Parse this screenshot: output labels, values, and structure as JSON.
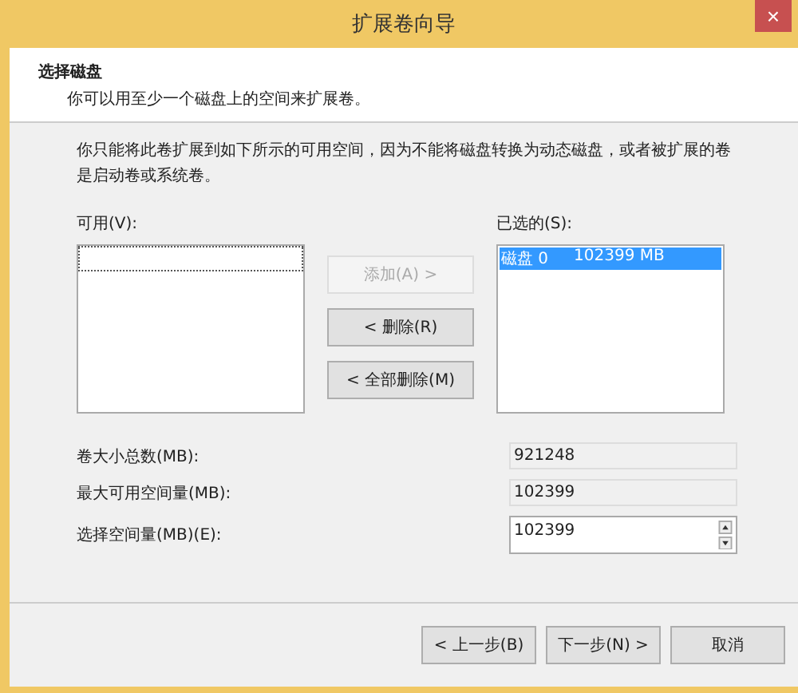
{
  "window": {
    "title": "扩展卷向导",
    "close": "×"
  },
  "header": {
    "title": "选择磁盘",
    "subtitle": "你可以用至少一个磁盘上的空间来扩展卷。"
  },
  "description": "你只能将此卷扩展到如下所示的可用空间，因为不能将磁盘转换为动态磁盘，或者被扩展的卷是启动卷或系统卷。",
  "available": {
    "label": "可用(V):"
  },
  "transfer_buttons": [
    {
      "label": "添加(A) >",
      "disabled": true
    },
    {
      "label": "< 删除(R)",
      "disabled": false
    },
    {
      "label": "< 全部删除(M)",
      "disabled": false
    }
  ],
  "selected_list": {
    "label": "已选的(S):",
    "items": [
      {
        "disk": "磁盘 0",
        "size": "102399 MB",
        "selected": true
      }
    ]
  },
  "fields": [
    {
      "label": "卷大小总数(MB):",
      "value": "921248",
      "kind": "readonly"
    },
    {
      "label": "最大可用空间量(MB):",
      "value": "102399",
      "kind": "readonly"
    },
    {
      "label": "选择空间量(MB)(E):",
      "value": "102399",
      "kind": "spinner"
    }
  ],
  "footer_buttons": [
    {
      "label": "< 上一步(B)"
    },
    {
      "label": "下一步(N) >"
    },
    {
      "label": "取消"
    }
  ]
}
